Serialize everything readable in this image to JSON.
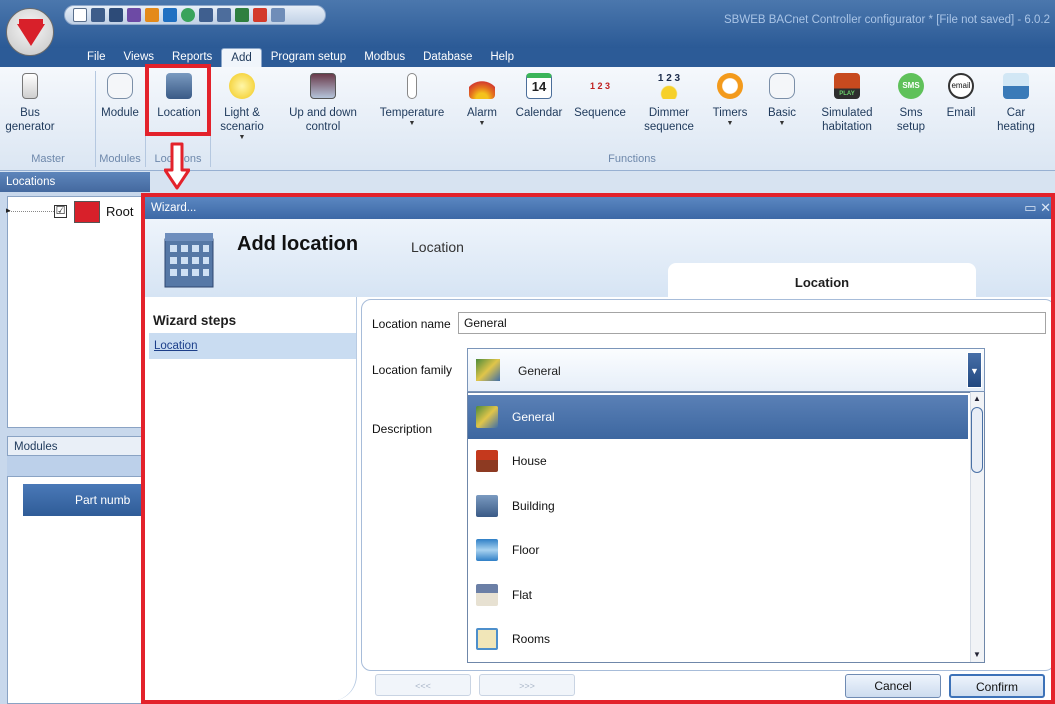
{
  "app": {
    "title": "SBWEB BACnet Controller configurator * [File not saved] - 6.0.2"
  },
  "menu": {
    "tabs": [
      {
        "label": "File"
      },
      {
        "label": "Views"
      },
      {
        "label": "Reports"
      },
      {
        "label": "Add"
      },
      {
        "label": "Program setup"
      },
      {
        "label": "Modbus"
      },
      {
        "label": "Database"
      },
      {
        "label": "Help"
      }
    ],
    "active_tab": "Add"
  },
  "ribbon": {
    "buttons": [
      {
        "label": "Bus",
        "label2": "generator",
        "dropdown": true
      },
      {
        "label": "Module",
        "label2": ""
      },
      {
        "label": "Location",
        "label2": ""
      },
      {
        "label": "Light &",
        "label2": "scenario",
        "dropdown": true
      },
      {
        "label": "Up and down",
        "label2": "control",
        "dropdown": true
      },
      {
        "label": "Temperature",
        "label2": "",
        "dropdown": true
      },
      {
        "label": "Alarm",
        "label2": "",
        "dropdown": true
      },
      {
        "label": "Calendar",
        "label2": ""
      },
      {
        "label": "Sequence",
        "label2": ""
      },
      {
        "label": "Dimmer",
        "label2": "sequence"
      },
      {
        "label": "Timers",
        "label2": "",
        "dropdown": true
      },
      {
        "label": "Basic",
        "label2": "",
        "dropdown": true
      },
      {
        "label": "Simulated",
        "label2": "habitation"
      },
      {
        "label": "Sms",
        "label2": "setup"
      },
      {
        "label": "Email",
        "label2": ""
      },
      {
        "label": "Car",
        "label2": "heating"
      }
    ],
    "groups": {
      "master": "Master",
      "modules": "Modules",
      "locations": "Locations",
      "functions": "Functions"
    },
    "icon_text": {
      "calendar": "14",
      "sequence": "1 2 3",
      "dimmer": "1 2 3",
      "sms": "SMS",
      "email": "email",
      "play": "PLAY"
    }
  },
  "left_panel": {
    "locations_title": "Locations",
    "tree_root": "Root",
    "modules_title": "Modules",
    "grid_column": "Part numb"
  },
  "wizard": {
    "window_title": "Wizard...",
    "controls": "▭ ✕",
    "title": "Add location",
    "subtitle": "Location",
    "step_tab": "Location",
    "steps_header": "Wizard steps",
    "steps": [
      {
        "label": "Location"
      }
    ],
    "fields": {
      "name_label": "Location name",
      "name_value": "General",
      "family_label": "Location family",
      "family_value": "General",
      "description_label": "Description"
    },
    "family_options": [
      {
        "label": "General",
        "icon": "general-icon",
        "selected": true
      },
      {
        "label": "House",
        "icon": "house-icon"
      },
      {
        "label": "Building",
        "icon": "building-icon"
      },
      {
        "label": "Floor",
        "icon": "floor-icon"
      },
      {
        "label": "Flat",
        "icon": "flat-icon"
      },
      {
        "label": "Rooms",
        "icon": "rooms-icon"
      }
    ],
    "nav_prev": "<<<",
    "nav_next": ">>>",
    "cancel": "Cancel",
    "confirm": "Confirm"
  },
  "colors": {
    "highlight": "#e3222b",
    "brand_red": "#d8202a",
    "title_blue": "#2b5a96"
  }
}
